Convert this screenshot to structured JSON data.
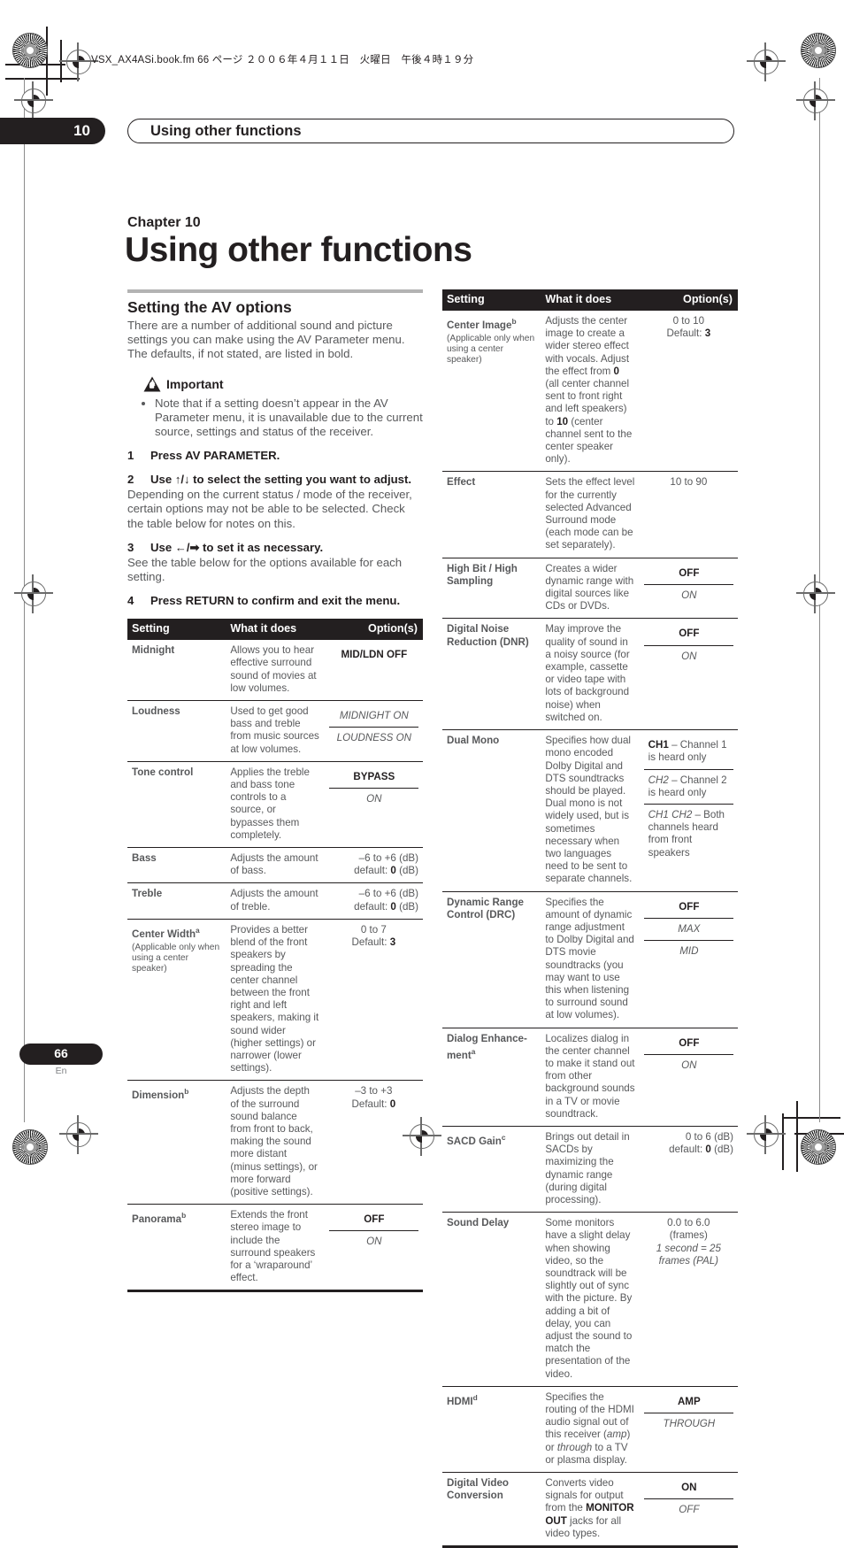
{
  "print_marks": {
    "file_line": "VSX_AX4ASi.book.fm  66 ページ  ２００６年４月１１日　火曜日　午後４時１９分"
  },
  "running_head": {
    "chapter_number": "10",
    "title": "Using other functions"
  },
  "chapter": {
    "label": "Chapter 10",
    "title": "Using other functions"
  },
  "left_column": {
    "section_title": "Setting the AV options",
    "intro": "There are a number of additional sound and picture settings you can make using the AV Parameter menu. The defaults, if not stated, are listed in bold.",
    "important_label": "Important",
    "important_bullets": [
      "Note that if a setting doesn’t appear in the AV Parameter menu, it is unavailable due to the current source, settings and status of the receiver."
    ],
    "steps": [
      {
        "num": "1",
        "head": "Press AV PARAMETER.",
        "body": ""
      },
      {
        "num": "2",
        "head_pre": "Use ",
        "head_arrows": "↑/↓",
        "head_post": " to select the setting you want to adjust.",
        "body": "Depending on the current status / mode of the receiver, certain options may not be able to be selected. Check the table below for notes on this."
      },
      {
        "num": "3",
        "head_pre": "Use ",
        "head_arrows": "←/➡",
        "head_post": " to set it as necessary.",
        "body": "See the table below for the options available for each setting."
      },
      {
        "num": "4",
        "head": "Press RETURN to confirm and exit the menu.",
        "body": ""
      }
    ]
  },
  "table_headers": {
    "setting": "Setting",
    "what": "What it does",
    "options": "Option(s)"
  },
  "left_table": [
    {
      "setting": "Midnight",
      "setting_note": "",
      "what": "Allows you to hear effective surround sound of movies at low volumes.",
      "options": [
        {
          "text": "MID/LDN OFF",
          "style": "bold"
        }
      ]
    },
    {
      "setting": "Loudness",
      "setting_note": "",
      "what": "Used to get good bass and treble from music sources at low volumes.",
      "options": [
        {
          "text": "MIDNIGHT ON",
          "style": "italic"
        },
        {
          "text": "LOUDNESS ON",
          "style": "italic"
        }
      ]
    },
    {
      "setting": "Tone control",
      "setting_note": "",
      "what": "Applies the treble and bass tone controls to a source, or bypasses them completely.",
      "options": [
        {
          "text": "BYPASS",
          "style": "bold"
        },
        {
          "text": "ON",
          "style": "italic"
        }
      ]
    },
    {
      "setting": "Bass",
      "setting_note": "",
      "what": "Adjusts the amount of bass.",
      "options": [
        {
          "text": "–6 to +6 (dB)",
          "style": "plain"
        },
        {
          "text": "default: 0 (dB)",
          "style": "plain-bold-value",
          "bold_part": "0"
        }
      ],
      "options_merged": true,
      "align": "right"
    },
    {
      "setting": "Treble",
      "setting_note": "",
      "what": "Adjusts the amount of treble.",
      "options": [
        {
          "text": "–6 to +6 (dB)",
          "style": "plain"
        },
        {
          "text": "default: 0 (dB)",
          "style": "plain-bold-value",
          "bold_part": "0"
        }
      ],
      "options_merged": true,
      "align": "right"
    },
    {
      "setting": "Center Width",
      "setting_sup": "a",
      "setting_note": "(Applicable only when using a center speaker)",
      "what": "Provides a better blend of the front speakers by spreading the center channel between the front right and left speakers, making it sound wider (higher settings) or narrower (lower settings).",
      "options": [
        {
          "text": "0 to 7",
          "style": "plain"
        },
        {
          "text": "Default: 3",
          "style": "plain-bold-value",
          "bold_part": "3"
        }
      ],
      "options_merged": true
    },
    {
      "setting": "Dimension",
      "setting_sup": "b",
      "setting_note": "",
      "what": "Adjusts the depth of the surround sound balance from front to back, making the sound more distant (minus settings), or more forward (positive settings).",
      "options": [
        {
          "text": "–3 to +3",
          "style": "plain"
        },
        {
          "text": "Default: 0",
          "style": "plain-bold-value",
          "bold_part": "0"
        }
      ],
      "options_merged": true
    },
    {
      "setting": "Panorama",
      "setting_sup": "b",
      "setting_note": "",
      "what": "Extends the front stereo image to include the surround speakers for a ‘wraparound’ effect.",
      "options": [
        {
          "text": "OFF",
          "style": "bold"
        },
        {
          "text": "ON",
          "style": "italic"
        }
      ]
    }
  ],
  "right_table": [
    {
      "setting": "Center Image",
      "setting_sup": "b",
      "setting_note": "(Applicable only when using a center speaker)",
      "what": "Adjusts the center image to create a wider stereo effect with vocals. Adjust the effect from 0 (all center channel sent to front right and left speakers) to 10 (center channel sent to the center speaker only).",
      "options": [
        {
          "text": "0 to 10",
          "style": "plain"
        },
        {
          "text": "Default: 3",
          "style": "plain-bold-value",
          "bold_part": "3"
        }
      ],
      "options_merged": true
    },
    {
      "setting": "Effect",
      "setting_note": "",
      "what": "Sets the effect level for the currently selected Advanced Surround mode (each mode can be set separately).",
      "options": [
        {
          "text": "10 to 90",
          "style": "plain"
        }
      ],
      "options_merged": true
    },
    {
      "setting": "High Bit / High Sampling",
      "setting_note": "",
      "what": "Creates a wider dynamic range with digital sources like CDs or DVDs.",
      "options": [
        {
          "text": "OFF",
          "style": "bold"
        },
        {
          "text": "ON",
          "style": "italic"
        }
      ]
    },
    {
      "setting": "Digital Noise Reduction (DNR)",
      "setting_note": "",
      "what": "May improve the quality of sound in a noisy source (for example, cassette or video tape with lots of background noise) when switched on.",
      "options": [
        {
          "text": "OFF",
          "style": "bold"
        },
        {
          "text": "ON",
          "style": "italic"
        }
      ]
    },
    {
      "setting": "Dual Mono",
      "setting_note": "",
      "what": "Specifies how dual mono encoded Dolby Digital and DTS soundtracks should be played. Dual mono is not widely used, but is sometimes necessary when two languages need to be sent to separate channels.",
      "options": [
        {
          "text": "CH1 – Channel 1 is heard only",
          "style": "mixed-bold-lead",
          "lead": "CH1"
        },
        {
          "text": "CH2 – Channel 2 is heard only",
          "style": "mixed-italic-lead",
          "lead": "CH2"
        },
        {
          "text": "CH1 CH2 – Both channels heard from front speakers",
          "style": "mixed-italic-lead",
          "lead": "CH1 CH2"
        }
      ],
      "align": "left"
    },
    {
      "setting": "Dynamic Range Control (DRC)",
      "setting_note": "",
      "what": "Specifies the amount of dynamic range adjustment to Dolby Digital and DTS movie soundtracks (you may want to use this when listening to surround sound at low volumes).",
      "options": [
        {
          "text": "OFF",
          "style": "bold"
        },
        {
          "text": "MAX",
          "style": "italic"
        },
        {
          "text": "MID",
          "style": "italic"
        }
      ]
    },
    {
      "setting": "Dialog Enhance-ment",
      "setting_sup": "a",
      "setting_note": "",
      "what": "Localizes dialog in the center channel to make it stand out from other background sounds in a TV or movie soundtrack.",
      "options": [
        {
          "text": "OFF",
          "style": "bold"
        },
        {
          "text": "ON",
          "style": "italic"
        }
      ]
    },
    {
      "setting": "SACD Gain",
      "setting_sup": "c",
      "setting_note": "",
      "what": "Brings out detail in SACDs by maximizing the dynamic range (during digital processing).",
      "options": [
        {
          "text": "0 to 6 (dB)",
          "style": "plain"
        },
        {
          "text": "default: 0 (dB)",
          "style": "plain-bold-value",
          "bold_part": "0"
        }
      ],
      "options_merged": true,
      "align": "right"
    },
    {
      "setting": "Sound Delay",
      "setting_note": "",
      "what": "Some monitors have a slight delay when showing video, so the soundtrack will be slightly out of sync with the picture. By adding a bit of delay, you can adjust the sound to match the presentation of the video.",
      "options": [
        {
          "text": "0.0 to 6.0",
          "style": "plain"
        },
        {
          "text": "(frames)",
          "style": "plain"
        },
        {
          "text": "1 second = 25 frames (PAL)",
          "style": "italic"
        }
      ],
      "options_merged": true
    },
    {
      "setting": "HDMI",
      "setting_sup": "d",
      "setting_note": "",
      "what": "Specifies the routing of the HDMI audio signal out of this receiver (amp) or through to a TV or plasma display.",
      "options": [
        {
          "text": "AMP",
          "style": "bold"
        },
        {
          "text": "THROUGH",
          "style": "italic"
        }
      ]
    },
    {
      "setting": "Digital Video Conversion",
      "setting_note": "",
      "what": "Converts video signals for output from the MONITOR OUT jacks for all video types.",
      "options": [
        {
          "text": "ON",
          "style": "bold"
        },
        {
          "text": "OFF",
          "style": "italic"
        }
      ]
    }
  ],
  "footer": {
    "page_number": "66",
    "language": "En"
  }
}
